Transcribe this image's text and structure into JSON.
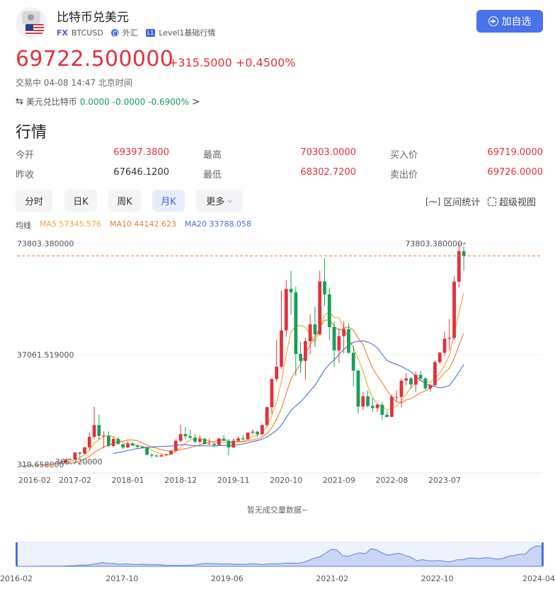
{
  "header": {
    "title": "比特币兑美元",
    "fx_badge": "FX",
    "symbol": "BTCUSD",
    "market": "外汇",
    "level_badge": "L1",
    "level_text": "Level1基础行情",
    "add_button": "加自选"
  },
  "quote": {
    "price": "69722.500000",
    "change": "+315.5000",
    "change_pct": "+0.4500%",
    "status": "交易中 04-08 14:47 北京时间"
  },
  "cross": {
    "label": "美元兑比特币",
    "price": "0.0000",
    "change": "-0.0000",
    "change_pct": "-0.6900%",
    "arrow": ">"
  },
  "section_title": "行情",
  "stats": [
    {
      "label": "今开",
      "value": "69397.3800",
      "color": "#e2323a"
    },
    {
      "label": "最高",
      "value": "70303.0000",
      "color": "#e2323a"
    },
    {
      "label": "买入价",
      "value": "69719.0000",
      "color": "#e2323a"
    },
    {
      "label": "昨收",
      "value": "67646.1200",
      "color": "#333333"
    },
    {
      "label": "最低",
      "value": "68302.7200",
      "color": "#e2323a"
    },
    {
      "label": "卖出价",
      "value": "69726.0000",
      "color": "#e2323a"
    }
  ],
  "tabs": [
    "分时",
    "日K",
    "周K",
    "月K",
    "更多"
  ],
  "active_tab": "月K",
  "tools": {
    "range_stats": "区间统计",
    "super_view": "超级视图"
  },
  "ma": {
    "label": "均线",
    "ma5": "MA5 57345.576",
    "ma10": "MA10 44142.623",
    "ma20": "MA20 33788.058"
  },
  "colors": {
    "up": "#e2323a",
    "down": "#16a05a",
    "accent": "#4a72ea",
    "ma5": "#f5a623",
    "ma10": "#ef7b2e",
    "ma20": "#4b6ee0"
  },
  "chart_data": {
    "type": "candlestick",
    "y_labels": [
      "73803.380000",
      "37061.519000",
      "319.658000"
    ],
    "max_marker": "73803.380000",
    "min_marker": "365.720000",
    "x_labels": [
      "2016-02",
      "2017-02",
      "2018-01",
      "2018-12",
      "2019-11",
      "2020-10",
      "2021-09",
      "2022-08",
      "2023-07"
    ],
    "ylim": [
      319.658,
      73803.38
    ],
    "last_price": 69722.5,
    "candles": [
      [
        420,
        380,
        450,
        360
      ],
      [
        380,
        430,
        460,
        370
      ],
      [
        430,
        420,
        470,
        400
      ],
      [
        420,
        610,
        640,
        410
      ],
      [
        610,
        700,
        760,
        590
      ],
      [
        700,
        740,
        790,
        680
      ],
      [
        740,
        970,
        1000,
        720
      ],
      [
        970,
        1100,
        1200,
        950
      ],
      [
        1100,
        1350,
        1400,
        1050
      ],
      [
        1350,
        2300,
        2500,
        1300
      ],
      [
        2300,
        2500,
        3000,
        2200
      ],
      [
        2500,
        4700,
        4900,
        2400
      ],
      [
        4700,
        4350,
        4900,
        3000
      ],
      [
        4350,
        6400,
        6500,
        4100
      ],
      [
        6400,
        9900,
        11300,
        5500
      ],
      [
        9900,
        13800,
        19800,
        9100
      ],
      [
        13800,
        10200,
        17200,
        9000
      ],
      [
        10200,
        10300,
        11800,
        6000
      ],
      [
        10300,
        6900,
        11700,
        6500
      ],
      [
        6900,
        9200,
        9900,
        6400
      ],
      [
        9200,
        7500,
        9900,
        7400
      ],
      [
        7500,
        6400,
        7600,
        5800
      ],
      [
        6400,
        7700,
        8500,
        6100
      ],
      [
        7700,
        7000,
        8300,
        6900
      ],
      [
        7000,
        6600,
        7400,
        6100
      ],
      [
        6600,
        6300,
        6800,
        6000
      ],
      [
        6300,
        4000,
        6500,
        3700
      ],
      [
        4000,
        3700,
        4300,
        3100
      ],
      [
        3700,
        3400,
        4100,
        3300
      ],
      [
        3400,
        3800,
        4200,
        3300
      ],
      [
        3800,
        4100,
        4300,
        3700
      ],
      [
        4100,
        5300,
        5500,
        4000
      ],
      [
        5300,
        8600,
        9100,
        5300
      ],
      [
        8600,
        10800,
        13900,
        8000
      ],
      [
        10800,
        10100,
        13200,
        9000
      ],
      [
        10100,
        9600,
        12300,
        9300
      ],
      [
        9600,
        8300,
        10900,
        7700
      ],
      [
        8300,
        9200,
        10400,
        7700
      ],
      [
        9200,
        7500,
        9600,
        7400
      ],
      [
        7500,
        7600,
        9400,
        7300
      ],
      [
        7600,
        7200,
        7800,
        6500
      ],
      [
        7200,
        9300,
        9600,
        6900
      ],
      [
        9300,
        8600,
        10500,
        8400
      ],
      [
        8600,
        6400,
        9200,
        3800
      ],
      [
        6400,
        8600,
        9400,
        6200
      ],
      [
        8600,
        9400,
        10000,
        8500
      ],
      [
        9400,
        9100,
        10400,
        8800
      ],
      [
        9100,
        11300,
        11400,
        8900
      ],
      [
        11300,
        11600,
        12400,
        10600
      ],
      [
        11600,
        10800,
        12000,
        9900
      ],
      [
        10800,
        13800,
        14000,
        10400
      ],
      [
        13800,
        19700,
        19900,
        13200
      ],
      [
        19700,
        29000,
        29300,
        17600
      ],
      [
        29000,
        33100,
        41900,
        28100
      ],
      [
        33100,
        45100,
        58300,
        32300
      ],
      [
        45100,
        58800,
        61800,
        43000
      ],
      [
        58800,
        57700,
        64800,
        50300
      ],
      [
        57700,
        37300,
        59500,
        30000
      ],
      [
        37300,
        35000,
        41300,
        31100
      ],
      [
        35000,
        41500,
        42500,
        28800
      ],
      [
        41500,
        47100,
        50400,
        37300
      ],
      [
        47100,
        43800,
        52900,
        39500
      ],
      [
        43800,
        61300,
        64800,
        43300
      ],
      [
        61300,
        57000,
        69000,
        53300
      ],
      [
        57000,
        46200,
        59200,
        42000
      ],
      [
        46200,
        38500,
        48000,
        32900
      ],
      [
        38500,
        43200,
        45800,
        34300
      ],
      [
        43200,
        45500,
        48200,
        37500
      ],
      [
        45500,
        37700,
        47500,
        37400
      ],
      [
        37700,
        31800,
        40000,
        26500
      ],
      [
        31800,
        19900,
        31900,
        17600
      ],
      [
        19900,
        23300,
        24600,
        18800
      ],
      [
        23300,
        20100,
        25200,
        19600
      ],
      [
        20100,
        19400,
        22800,
        18100
      ],
      [
        19400,
        20500,
        20900,
        18200
      ],
      [
        20500,
        17200,
        21400,
        15500
      ],
      [
        17200,
        16500,
        18300,
        16300
      ],
      [
        16500,
        23100,
        23900,
        16500
      ],
      [
        23100,
        23100,
        25200,
        21400
      ],
      [
        23100,
        28500,
        29200,
        19600
      ],
      [
        28500,
        29200,
        31000,
        26900
      ],
      [
        29200,
        27200,
        29800,
        25800
      ],
      [
        27200,
        30400,
        31400,
        24800
      ],
      [
        30400,
        29200,
        31800,
        28900
      ],
      [
        29200,
        25900,
        29600,
        25400
      ],
      [
        25900,
        27000,
        27400,
        24900
      ],
      [
        27000,
        34600,
        35200,
        26500
      ],
      [
        34600,
        37700,
        38000,
        34100
      ],
      [
        37700,
        42300,
        44700,
        36700
      ],
      [
        42300,
        42600,
        48900,
        38500
      ],
      [
        42600,
        61200,
        63000,
        41900
      ],
      [
        61200,
        71300,
        73803,
        59200
      ],
      [
        71300,
        69722,
        72800,
        64800
      ]
    ],
    "ma5": [],
    "ma10": [],
    "ma20": [],
    "no_volume_text": "暂无成交量数据~",
    "navigator": {
      "x_labels": [
        "2016-02",
        "2017-10",
        "2019-06",
        "2021-02",
        "2022-10",
        "2024-04"
      ]
    }
  }
}
